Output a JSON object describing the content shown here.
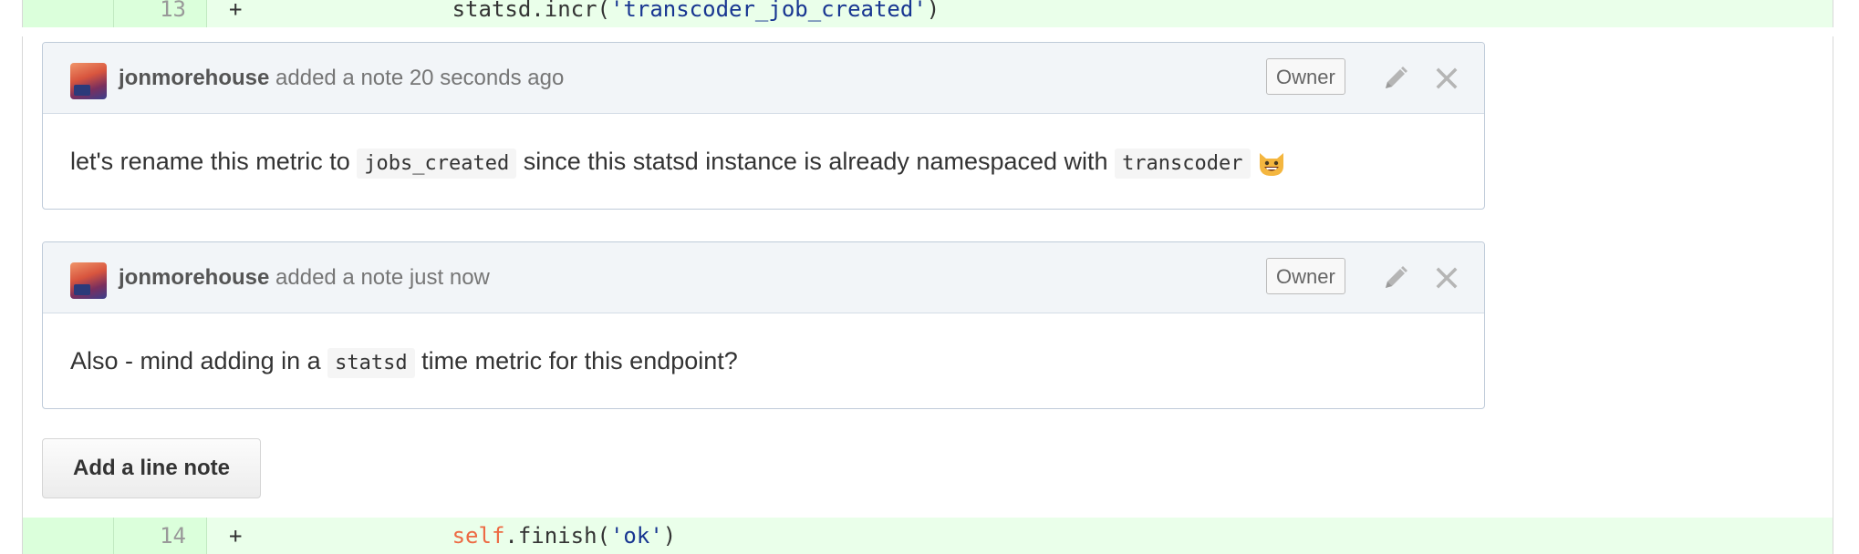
{
  "diff": {
    "row_top": {
      "line_number": "13",
      "marker": "+",
      "code_prefix": "        statsd.incr(",
      "code_string": "'transcoder_job_created'",
      "code_suffix": ")"
    },
    "row_bottom": {
      "line_number": "14",
      "marker": "+",
      "code_indent": "        ",
      "code_self": "self",
      "code_method": ".finish(",
      "code_string": "'ok'",
      "code_suffix": ")"
    }
  },
  "notes": [
    {
      "author": "jonmorehouse",
      "action_text": " added a note 20 seconds ago",
      "badge": "Owner",
      "body": {
        "text_1": "let's rename this metric to ",
        "code_1": "jobs_created",
        "text_2": " since this statsd instance is already namespaced with ",
        "code_2": "transcoder",
        "emoji": "smiley-cat-emoji"
      }
    },
    {
      "author": "jonmorehouse",
      "action_text": " added a note just now",
      "badge": "Owner",
      "body": {
        "text_1": "Also - mind adding in a ",
        "code_1": "statsd",
        "text_2": " time metric for this endpoint?"
      }
    }
  ],
  "add_note_button": "Add a line note",
  "icons": {
    "edit": "pencil-icon",
    "delete": "close-icon",
    "avatar": "avatar"
  },
  "colors": {
    "added_line_bg": "#eaffea",
    "string_token": "#183691",
    "self_token": "#ed6a43",
    "note_header_bg": "#f2f5f8"
  }
}
